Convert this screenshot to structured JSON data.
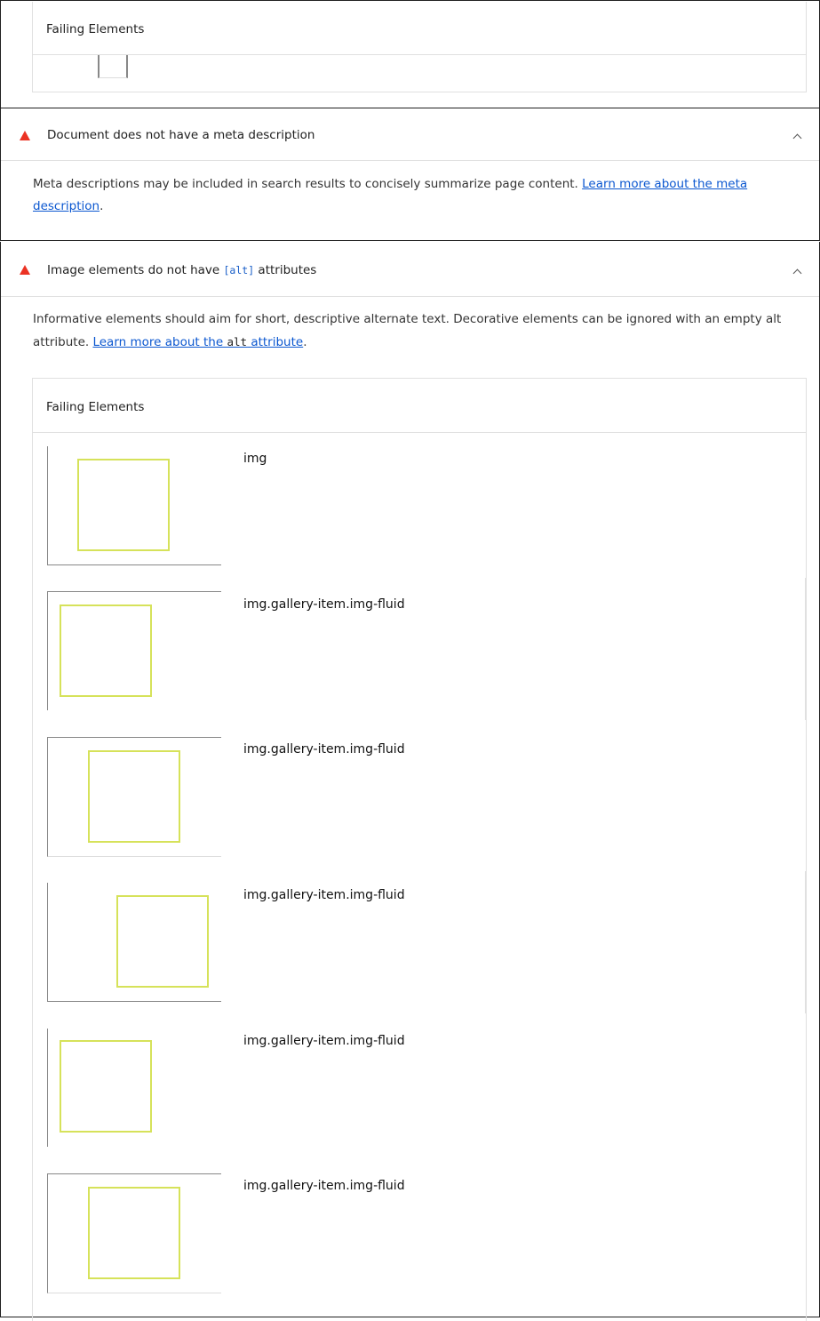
{
  "top_panel": {
    "header": "Failing Elements"
  },
  "audits": [
    {
      "title": "Document does not have a meta description",
      "description": "Meta descriptions may be included in search results to concisely summarize page content. ",
      "link_text": "Learn more about the meta description",
      "description_end": "."
    },
    {
      "title_before": "Image elements do not have ",
      "title_code": "[alt]",
      "title_after": " attributes",
      "description": "Informative elements should aim for short, descriptive alternate text. Decorative elements can be ignored with an empty alt attribute. ",
      "link_before": "Learn more about the ",
      "link_code": "alt",
      "link_after": " attribute",
      "description_end": ".",
      "table_header": "Failing Elements",
      "elements": [
        {
          "selector": "img"
        },
        {
          "selector": "img.gallery-item.img-fluid"
        },
        {
          "selector": "img.gallery-item.img-fluid"
        },
        {
          "selector": "img.gallery-item.img-fluid"
        },
        {
          "selector": "img.gallery-item.img-fluid"
        },
        {
          "selector": "img.gallery-item.img-fluid"
        }
      ]
    }
  ],
  "colors": {
    "fail": "#eb3223",
    "link": "#0b57d0",
    "highlight": "#d6e25a"
  }
}
